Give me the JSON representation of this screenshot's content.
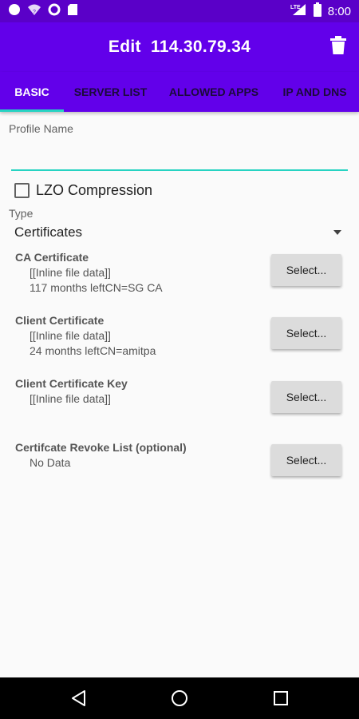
{
  "status_bar": {
    "time": "8:00",
    "network": "LTE",
    "icons": [
      "circle-notification-icon",
      "wifi-question-icon",
      "vpn-ring-icon",
      "sd-card-icon",
      "signal-icon",
      "battery-icon"
    ]
  },
  "toolbar": {
    "title": "Edit  114.30.79.34",
    "action_icon": "trash-icon"
  },
  "tabs": [
    {
      "label": "BASIC",
      "active": true
    },
    {
      "label": "SERVER LIST",
      "active": false
    },
    {
      "label": "ALLOWED APPS",
      "active": false
    },
    {
      "label": "IP AND DNS",
      "active": false
    }
  ],
  "form": {
    "profile_name_label": "Profile Name",
    "profile_name_value": "",
    "lzo_label": "LZO Compression",
    "lzo_checked": false,
    "type_label": "Type",
    "type_value": "Certificates"
  },
  "certificates": [
    {
      "title": "CA Certificate",
      "lines": [
        "[[Inline file data]]",
        "117 months leftCN=SG CA"
      ],
      "button": "Select..."
    },
    {
      "title": "Client Certificate",
      "lines": [
        "[[Inline file data]]",
        "24 months leftCN=amitpa"
      ],
      "button": "Select..."
    },
    {
      "title": "Client Certificate Key",
      "lines": [
        "[[Inline file data]]"
      ],
      "button": "Select..."
    },
    {
      "title": "Certifcate Revoke List (optional)",
      "lines": [
        "No Data"
      ],
      "button": "Select..."
    }
  ],
  "colors": {
    "status_bar": "#5a00c8",
    "primary": "#6200ea",
    "accent": "#26d3c2",
    "background": "#fafafa",
    "nav_bar": "#000000"
  },
  "nav": [
    "back-icon",
    "home-icon",
    "recents-icon"
  ]
}
